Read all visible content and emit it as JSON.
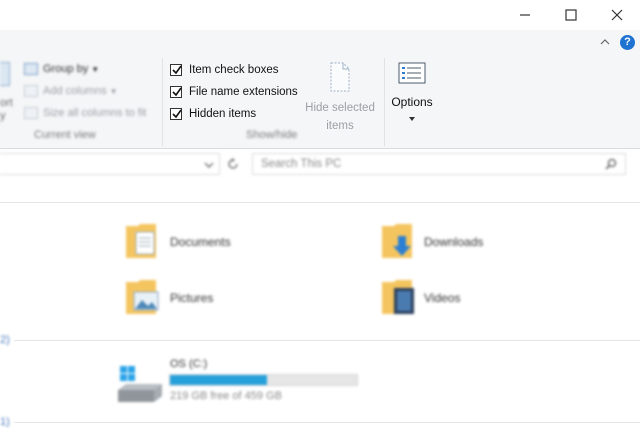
{
  "ribbon": {
    "layout_items": {
      "group_by": "Group by",
      "add_columns": "Add columns",
      "size_columns": "Size all columns to fit"
    },
    "current_view_caption": "Current view",
    "left_partial_labels": [
      "ort",
      "y"
    ],
    "show_hide": {
      "caption": "Show/hide",
      "item_check_boxes": {
        "label": "Item check boxes",
        "checked": true
      },
      "file_name_extensions": {
        "label": "File name extensions",
        "checked": true
      },
      "hidden_items": {
        "label": "Hidden items",
        "checked": true
      },
      "hide_selected_line1": "Hide selected",
      "hide_selected_line2": "items"
    },
    "options_label": "Options"
  },
  "search": {
    "placeholder": "Search This PC"
  },
  "folders": [
    {
      "label": "Documents"
    },
    {
      "label": "Downloads"
    },
    {
      "label": "Pictures"
    },
    {
      "label": "Videos"
    }
  ],
  "sections": {
    "devices_count_mark": "2)",
    "network_mark": "1)"
  },
  "drive": {
    "name": "OS (C:)",
    "free_text": "219 GB free of 459 GB",
    "used_fraction": 0.52
  },
  "colors": {
    "accent": "#26a0da",
    "help": "#1e73d2",
    "folder": "#f4c55f"
  }
}
